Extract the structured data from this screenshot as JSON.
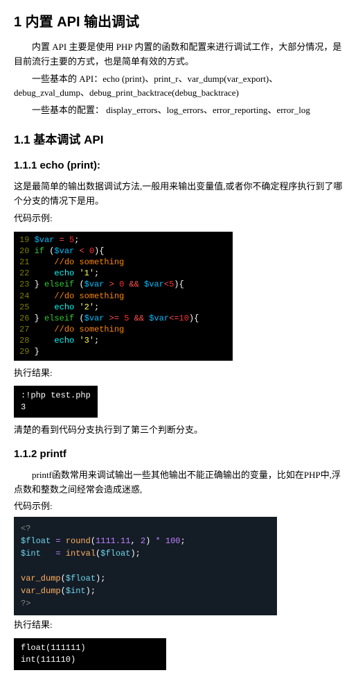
{
  "h1": "1 内置 API 输出调试",
  "p1": "内置 API 主要是使用 PHP 内置的函数和配置来进行调试工作，大部分情况，是目前流行主要的方式，也是简单有效的方式。",
  "p2": "一些基本的 API：echo (print)、print_r、var_dump(var_export)、debug_zval_dump、debug_print_backtrace(debug_backtrace)",
  "p3": "一些基本的配置：   display_errors、log_errors、error_reporting、error_log",
  "h2_11": "1.1  基本调试 API",
  "h3_111": "1.1.1  echo (print):",
  "p111_1": "这是最简单的输出数据调试方法,一般用来输出变量值,或者你不确定程序执行到了哪个分支的情况下是用。",
  "label_code": "代码示例:",
  "label_result": "执行结果:",
  "code1": {
    "l19": {
      "ln": "19",
      "t": " $var = 5;"
    },
    "l20": {
      "ln": "20",
      "t": " if ($var < 0){"
    },
    "l21": {
      "ln": "21",
      "t": "     //do something"
    },
    "l22": {
      "ln": "22",
      "t": "     echo '1';"
    },
    "l23": {
      "ln": "23",
      "t": " } elseif ($var > 0 && $var<5){"
    },
    "l24": {
      "ln": "24",
      "t": "     //do something"
    },
    "l25": {
      "ln": "25",
      "t": "     echo '2';"
    },
    "l26": {
      "ln": "26",
      "t": " } elseif ($var >= 5 && $var<=10){"
    },
    "l27": {
      "ln": "27",
      "t": "     //do something"
    },
    "l28": {
      "ln": "28",
      "t": "     echo '3';"
    },
    "l29": {
      "ln": "29",
      "t": " }"
    }
  },
  "term1": ":!php test.php\n3",
  "p111_2": "清楚的看到代码分支执行到了第三个判断分支。",
  "h3_112": "1.1.2  printf",
  "p112_1": "printf函数常用来调试输出一些其他输出不能正确输出的变量，比如在PHP中,浮点数和整数之间经常会造成迷惑,",
  "code2_l1": "<?",
  "code2_l2": "$float = round(1111.11, 2) * 100;",
  "code2_l3": "$int   = intval($float);",
  "code2_l4": " ",
  "code2_l5": "var_dump($float);",
  "code2_l6": "var_dump($int);",
  "code2_l7": "?>",
  "term2": "float(111111)\nint(111110)"
}
